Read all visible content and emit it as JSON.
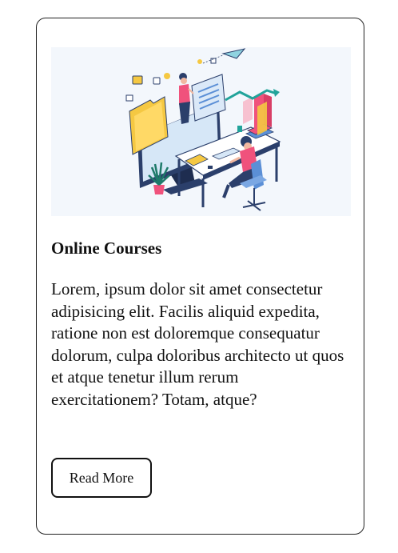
{
  "card": {
    "title": "Online Courses",
    "description": "Lorem, ipsum dolor sit amet consectetur adipisicing elit. Facilis aliquid expedita, ratione non est doloremque consequatur dolorum, culpa doloribus architecto ut quos et atque tenetur illum rerum exercitationem? Totam, atque?",
    "button_label": "Read More"
  },
  "illustration": {
    "subject": "isometric online-learning illustration: person at desk with computer, presenter on monitor, folder, charts",
    "colors": {
      "background": "#f3f7fc",
      "monitor": "#2b3f6b",
      "screen": "#d6e7f7",
      "folder": "#f5c842",
      "accent_pink": "#f0527c",
      "accent_teal": "#21a39a",
      "chair": "#5b8fd6"
    }
  }
}
